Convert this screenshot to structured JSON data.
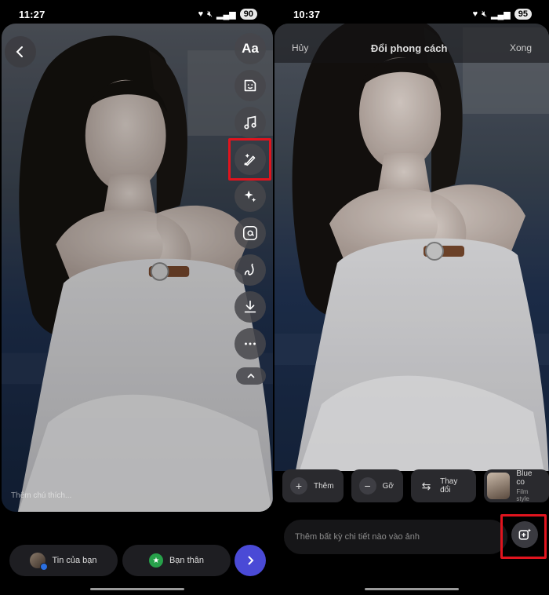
{
  "left": {
    "status": {
      "time": "11:27",
      "battery": "90"
    },
    "tools": [
      {
        "name": "text-tool",
        "label": "Aa"
      },
      {
        "name": "sticker-icon"
      },
      {
        "name": "music-icon"
      },
      {
        "name": "brush-sparkle-icon"
      },
      {
        "name": "sparkles-icon"
      },
      {
        "name": "mention-icon"
      },
      {
        "name": "draw-icon"
      },
      {
        "name": "download-icon"
      },
      {
        "name": "more-icon"
      }
    ],
    "caption_placeholder": "Thêm chú thích...",
    "bottom": {
      "your_story": "Tin của bạn",
      "close_friends": "Bạn thân"
    }
  },
  "right": {
    "status": {
      "time": "10:37",
      "battery": "95"
    },
    "header": {
      "cancel": "Hủy",
      "title": "Đổi phong cách",
      "done": "Xong"
    },
    "chips": [
      {
        "label": "Thêm",
        "icon": "plus-icon"
      },
      {
        "label": "Gỡ",
        "icon": "minus-icon"
      },
      {
        "label": "Thay đổi",
        "icon": "swap-icon"
      },
      {
        "label": "Blue co",
        "sub": "Film style"
      }
    ],
    "prompt_placeholder": "Thêm bất kỳ chi tiết nào vào ảnh"
  },
  "colors": {
    "highlight": "#e0141e",
    "send": "#4a4ad6"
  }
}
